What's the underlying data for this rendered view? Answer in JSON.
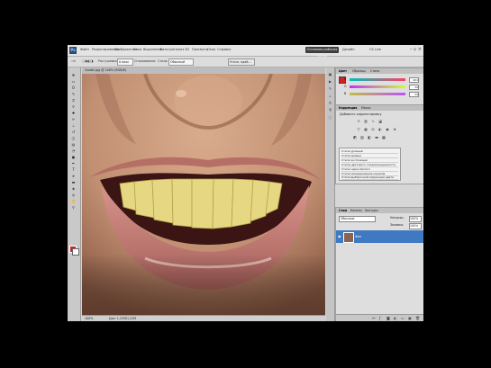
{
  "app": {
    "logo": "Ps"
  },
  "menubar": {
    "items": [
      "Файл",
      "Редактирование",
      "Изображение",
      "Слои",
      "Выделение",
      "Фильтр",
      "Анализ",
      "3D",
      "Просмотр",
      "Окно",
      "Справка"
    ],
    "workspace_active": "Основная рабочая среда",
    "workspace_2": "Дизайн",
    "cs_live": "CS Live"
  },
  "options": {
    "feather_label": "Растушевка:",
    "feather_value": "0 пикс",
    "smooth_label": "Сглаживание",
    "style_label": "Стиль:",
    "style_value": "Обычный",
    "refine_button": "Уточн. край..."
  },
  "document": {
    "tab": "Смайл.jpg @ 100% (RGB/8)",
    "zoom": "100%",
    "status": "Док: 1,22M/1,22M"
  },
  "color_panel": {
    "tabs": [
      "Цвет",
      "Образцы",
      "Стили"
    ],
    "sliders": [
      {
        "label": "R",
        "value": "201",
        "gradient": "linear-gradient(90deg,#00c0c0,#ff4060)"
      },
      {
        "label": "G",
        "value": "39",
        "gradient": "linear-gradient(90deg,#c030ff,#d0ff30)"
      },
      {
        "label": "B",
        "value": "39",
        "gradient": "linear-gradient(90deg,#c0c040,#c050ff)"
      }
    ],
    "fg_color": "#d61f1f"
  },
  "adjustments_panel": {
    "tabs": [
      "Коррекция",
      "Маски"
    ],
    "heading": "Добавить корректировку",
    "presets": [
      "Стили уровней",
      "Стили кривых",
      "Стили экспозиции",
      "Стили цветового тона/насыщенности",
      "Стили черно-белого",
      "Стили микширования каналов",
      "Стили выборочной коррекции цвета"
    ]
  },
  "layers_panel": {
    "tabs": [
      "Слои",
      "Каналы",
      "Контуры"
    ],
    "blend_mode": "Обычные",
    "opacity_label": "Непрозр.:",
    "opacity_value": "100%",
    "fill_label": "Заливка:",
    "fill_value": "100%",
    "layer_name": "Фон",
    "layer_selected_color": "#3f79c2"
  }
}
